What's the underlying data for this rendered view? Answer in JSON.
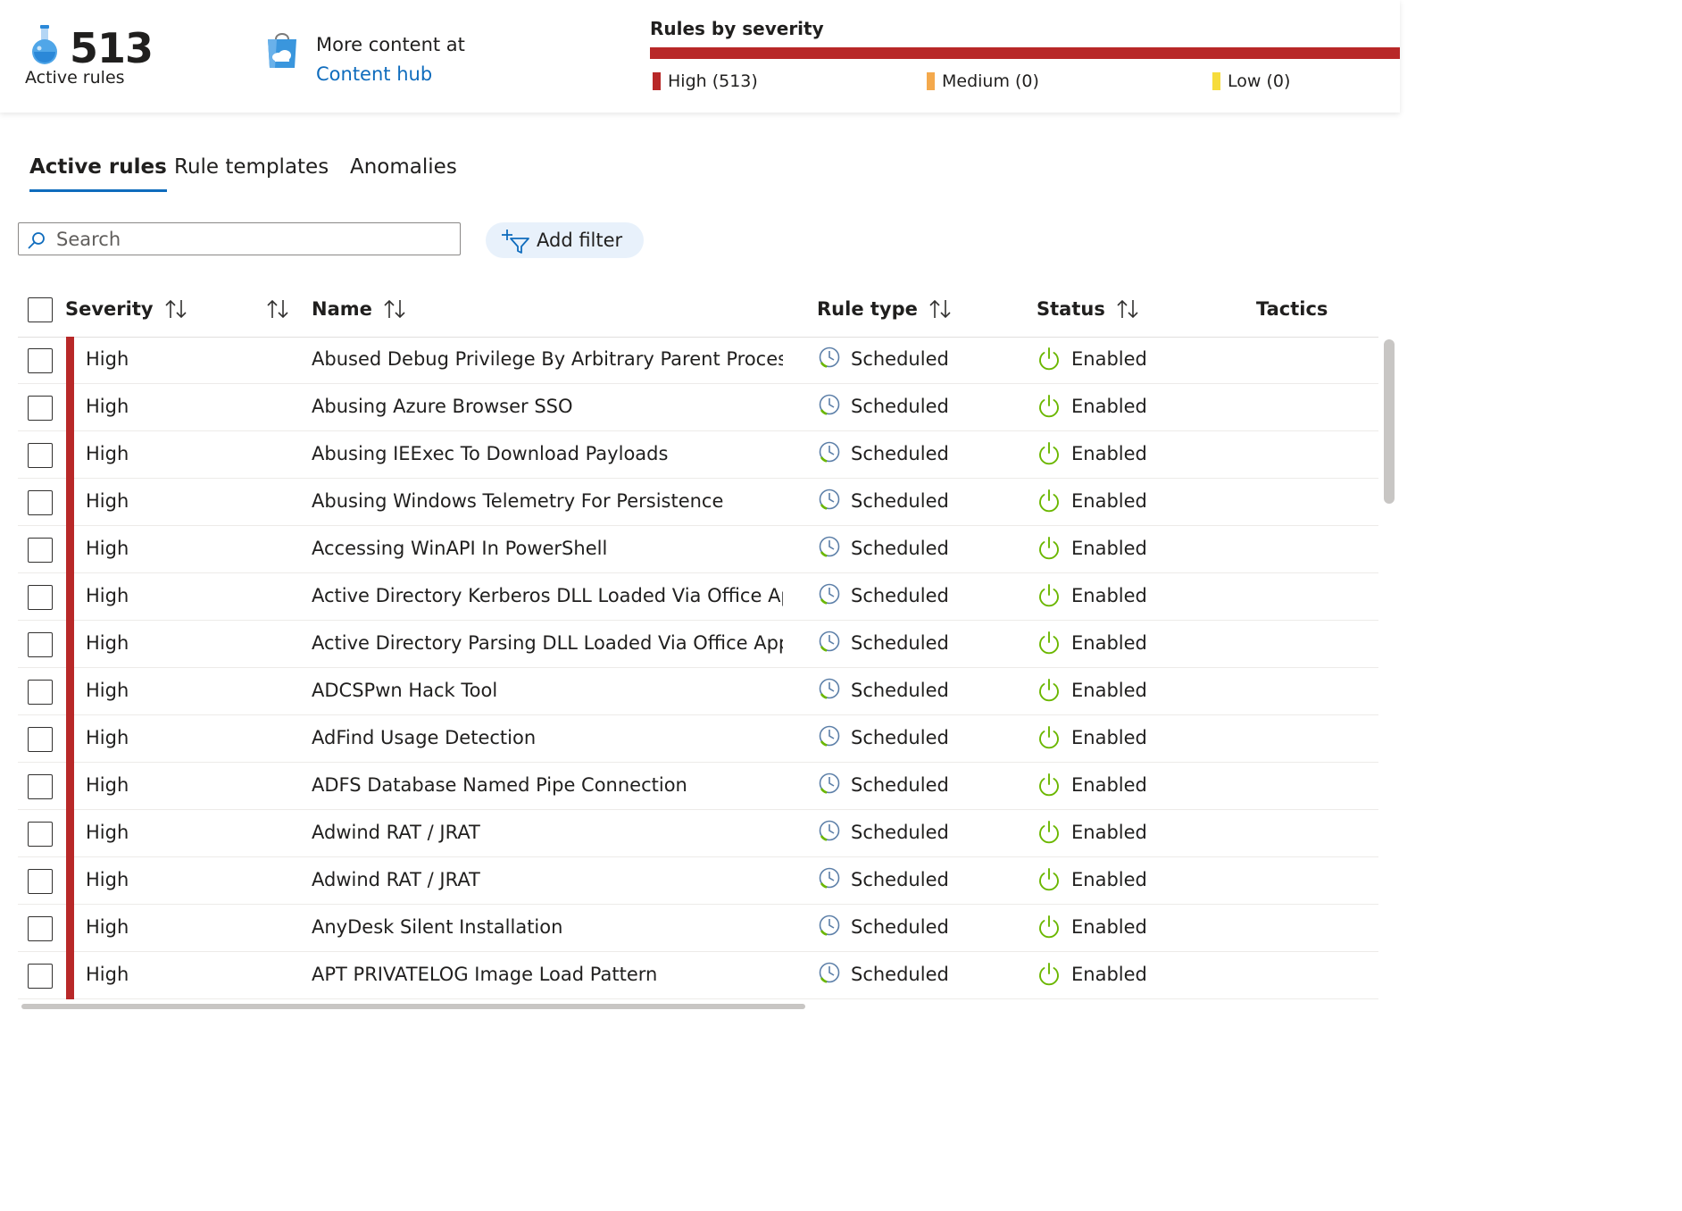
{
  "summary": {
    "active_rules_count": "513",
    "active_rules_label": "Active rules",
    "content_text": "More content at",
    "content_link": "Content hub",
    "severity_title": "Rules by severity",
    "severity_legend": [
      {
        "label": "High (513)",
        "color": "#b82828"
      },
      {
        "label": "Medium (0)",
        "color": "#f4a94c"
      },
      {
        "label": "Low (0)",
        "color": "#f6dc3c"
      }
    ]
  },
  "tabs": [
    "Active rules",
    "Rule templates",
    "Anomalies"
  ],
  "active_tab": "Active rules",
  "search": {
    "placeholder": "Search",
    "value": ""
  },
  "add_filter_label": "Add filter",
  "columns": {
    "severity": "Severity",
    "name": "Name",
    "rule_type": "Rule type",
    "status": "Status",
    "tactics": "Tactics"
  },
  "rows": [
    {
      "severity": "High",
      "name": "Abused Debug Privilege By Arbitrary Parent Processes",
      "rule_type": "Scheduled",
      "status": "Enabled"
    },
    {
      "severity": "High",
      "name": "Abusing Azure Browser SSO",
      "rule_type": "Scheduled",
      "status": "Enabled"
    },
    {
      "severity": "High",
      "name": "Abusing IEExec To Download Payloads",
      "rule_type": "Scheduled",
      "status": "Enabled"
    },
    {
      "severity": "High",
      "name": "Abusing Windows Telemetry For Persistence",
      "rule_type": "Scheduled",
      "status": "Enabled"
    },
    {
      "severity": "High",
      "name": "Accessing WinAPI In PowerShell",
      "rule_type": "Scheduled",
      "status": "Enabled"
    },
    {
      "severity": "High",
      "name": "Active Directory Kerberos DLL Loaded Via Office Appl...",
      "rule_type": "Scheduled",
      "status": "Enabled"
    },
    {
      "severity": "High",
      "name": "Active Directory Parsing DLL Loaded Via Office Applic...",
      "rule_type": "Scheduled",
      "status": "Enabled"
    },
    {
      "severity": "High",
      "name": "ADCSPwn Hack Tool",
      "rule_type": "Scheduled",
      "status": "Enabled"
    },
    {
      "severity": "High",
      "name": "AdFind Usage Detection",
      "rule_type": "Scheduled",
      "status": "Enabled"
    },
    {
      "severity": "High",
      "name": "ADFS Database Named Pipe Connection",
      "rule_type": "Scheduled",
      "status": "Enabled"
    },
    {
      "severity": "High",
      "name": "Adwind RAT / JRAT",
      "rule_type": "Scheduled",
      "status": "Enabled"
    },
    {
      "severity": "High",
      "name": "Adwind RAT / JRAT",
      "rule_type": "Scheduled",
      "status": "Enabled"
    },
    {
      "severity": "High",
      "name": "AnyDesk Silent Installation",
      "rule_type": "Scheduled",
      "status": "Enabled"
    },
    {
      "severity": "High",
      "name": "APT PRIVATELOG Image Load Pattern",
      "rule_type": "Scheduled",
      "status": "Enabled"
    }
  ],
  "colors": {
    "accent": "#0f6cbd",
    "severity_high": "#b82828",
    "status_enabled": "#6bb700",
    "filter_button_bg": "#e8f1fb"
  },
  "icons": {
    "metric": "flask-icon",
    "content_hub": "shopping-bag-cloud-icon",
    "search": "search-icon",
    "add_filter": "add-filter-icon",
    "sort": "sort-arrows-icon",
    "rule_type": "clock-icon",
    "status": "power-icon"
  }
}
